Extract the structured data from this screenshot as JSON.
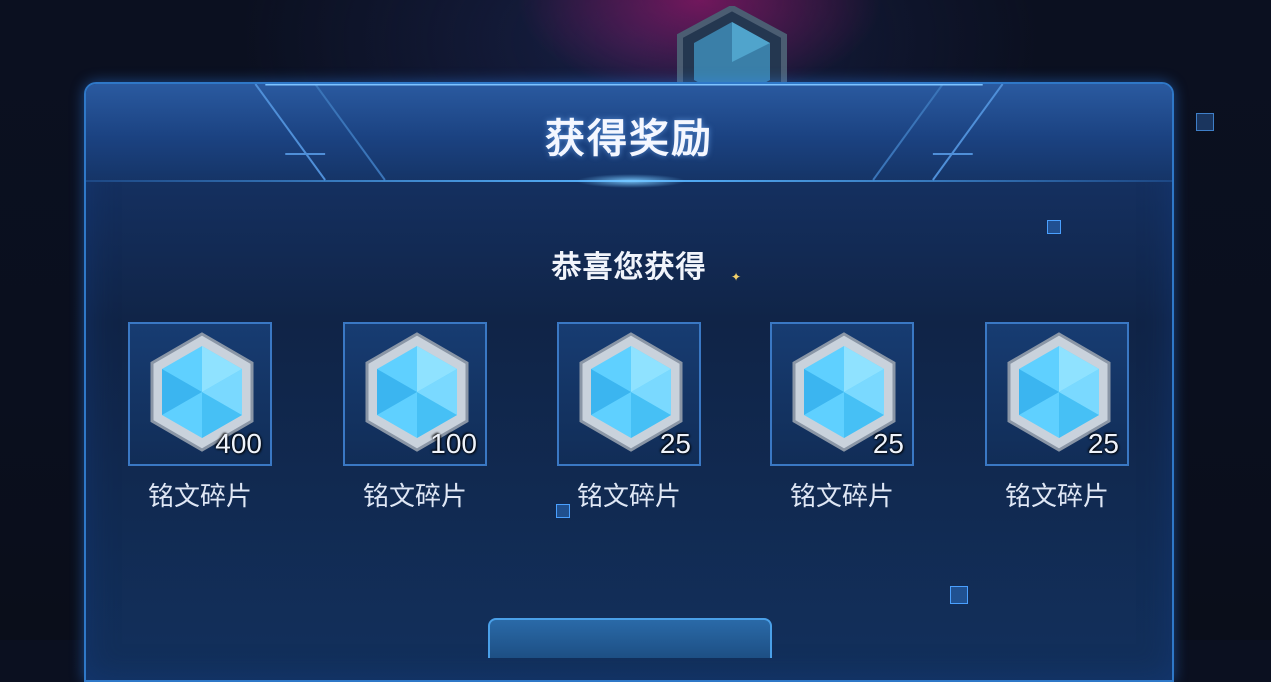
{
  "dialog": {
    "title": "获得奖励",
    "subtitle": "恭喜您获得",
    "rewards": [
      {
        "name": "铭文碎片",
        "count": "400",
        "icon": "crystal-hexagon-icon"
      },
      {
        "name": "铭文碎片",
        "count": "100",
        "icon": "crystal-hexagon-icon"
      },
      {
        "name": "铭文碎片",
        "count": "25",
        "icon": "crystal-hexagon-icon"
      },
      {
        "name": "铭文碎片",
        "count": "25",
        "icon": "crystal-hexagon-icon"
      },
      {
        "name": "铭文碎片",
        "count": "25",
        "icon": "crystal-hexagon-icon"
      }
    ]
  },
  "colors": {
    "panel_border": "#2f78c8",
    "accent_glow": "#57b4ff",
    "crystal": "#5fd0ff",
    "text": "#f4f7ff"
  }
}
